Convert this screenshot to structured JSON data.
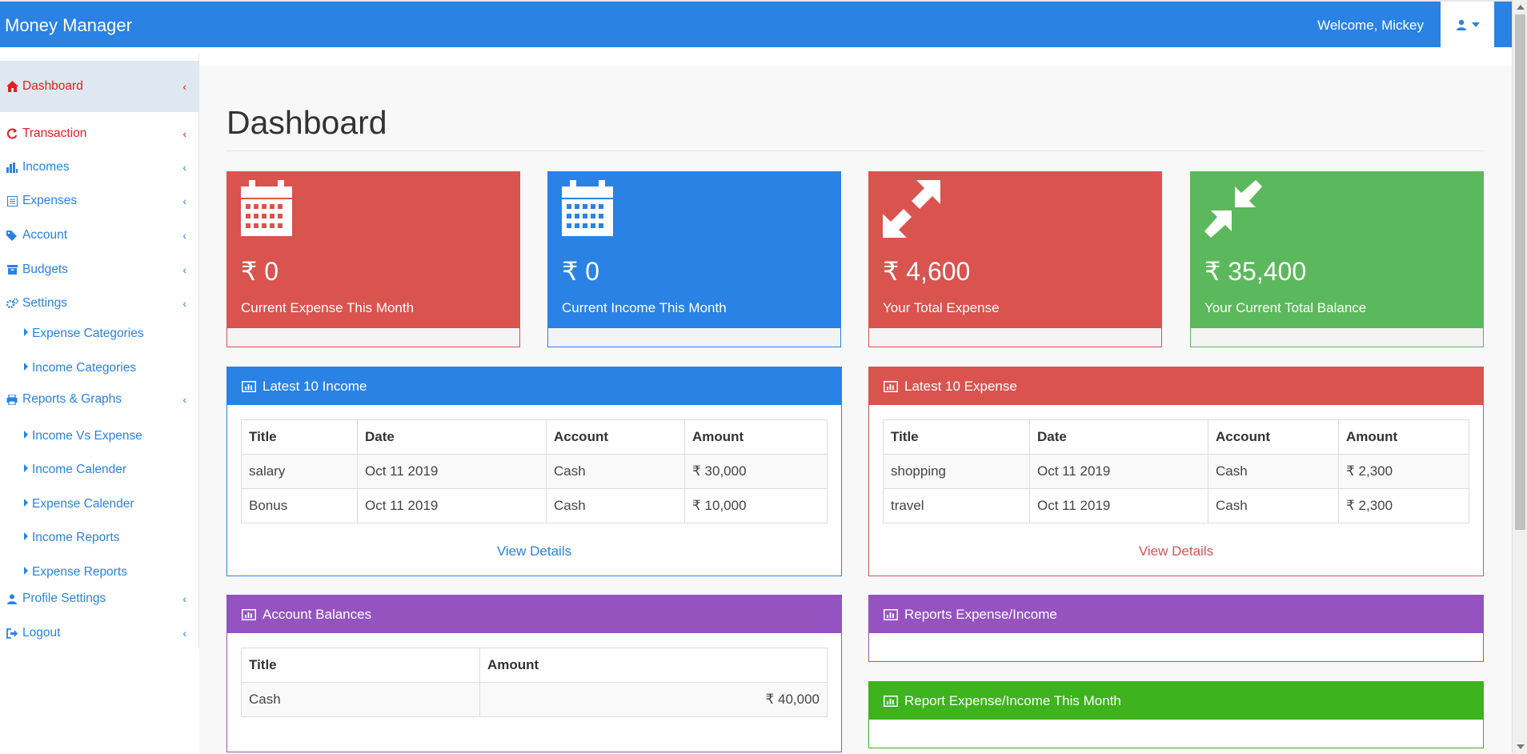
{
  "header": {
    "brand": "Money Manager",
    "welcome": "Welcome, Mickey"
  },
  "sidebar": {
    "items": [
      {
        "label": "Dashboard",
        "icon": "home-icon"
      },
      {
        "label": "Transaction",
        "icon": "refresh-icon"
      },
      {
        "label": "Incomes",
        "icon": "bar-chart-icon"
      },
      {
        "label": "Expenses",
        "icon": "list-icon"
      },
      {
        "label": "Account",
        "icon": "tags-icon"
      },
      {
        "label": "Budgets",
        "icon": "archive-icon"
      },
      {
        "label": "Settings",
        "icon": "cogs-icon"
      },
      {
        "label": "Reports & Graphs",
        "icon": "print-icon"
      },
      {
        "label": "Profile Settings",
        "icon": "user-icon"
      },
      {
        "label": "Logout",
        "icon": "sign-out-icon"
      }
    ],
    "settings_sub": [
      "Expense Categories",
      "Income Categories"
    ],
    "reports_sub": [
      "Income Vs Expense",
      "Income Calender",
      "Expense Calender",
      "Income Reports",
      "Expense Reports"
    ]
  },
  "main": {
    "title": "Dashboard",
    "cards": [
      {
        "amount": "₹ 0",
        "label": "Current Expense This Month",
        "color": "#d9534f",
        "icon": "calendar-icon"
      },
      {
        "amount": "₹ 0",
        "label": "Current Income This Month",
        "color": "#2a82e4",
        "icon": "calendar-icon"
      },
      {
        "amount": "₹ 4,600",
        "label": "Your Total Expense",
        "color": "#d9534f",
        "icon": "expand-arrows-icon"
      },
      {
        "amount": "₹ 35,400",
        "label": "Your Current Total Balance",
        "color": "#5cb85c",
        "icon": "compress-arrows-icon"
      }
    ],
    "income_panel": {
      "title": "Latest 10 Income",
      "columns": [
        "Title",
        "Date",
        "Account",
        "Amount"
      ],
      "rows": [
        [
          "salary",
          "Oct 11 2019",
          "Cash",
          "₹ 30,000"
        ],
        [
          "Bonus",
          "Oct 11 2019",
          "Cash",
          "₹ 10,000"
        ]
      ],
      "link": "View Details"
    },
    "expense_panel": {
      "title": "Latest 10 Expense",
      "columns": [
        "Title",
        "Date",
        "Account",
        "Amount"
      ],
      "rows": [
        [
          "shopping",
          "Oct 11 2019",
          "Cash",
          "₹ 2,300"
        ],
        [
          "travel",
          "Oct 11 2019",
          "Cash",
          "₹ 2,300"
        ]
      ],
      "link": "View Details"
    },
    "balances_panel": {
      "title": "Account Balances",
      "columns": [
        "Title",
        "Amount"
      ],
      "rows": [
        [
          "Cash",
          "₹ 40,000"
        ]
      ]
    },
    "reports_panel": {
      "title": "Reports Expense/Income"
    },
    "report_month_panel": {
      "title": "Report Expense/Income This Month"
    }
  },
  "colors": {
    "primary": "#2a82e4",
    "danger": "#d9534f",
    "success": "#5cb85c",
    "purple": "#9553c0",
    "green": "#3db31e"
  }
}
